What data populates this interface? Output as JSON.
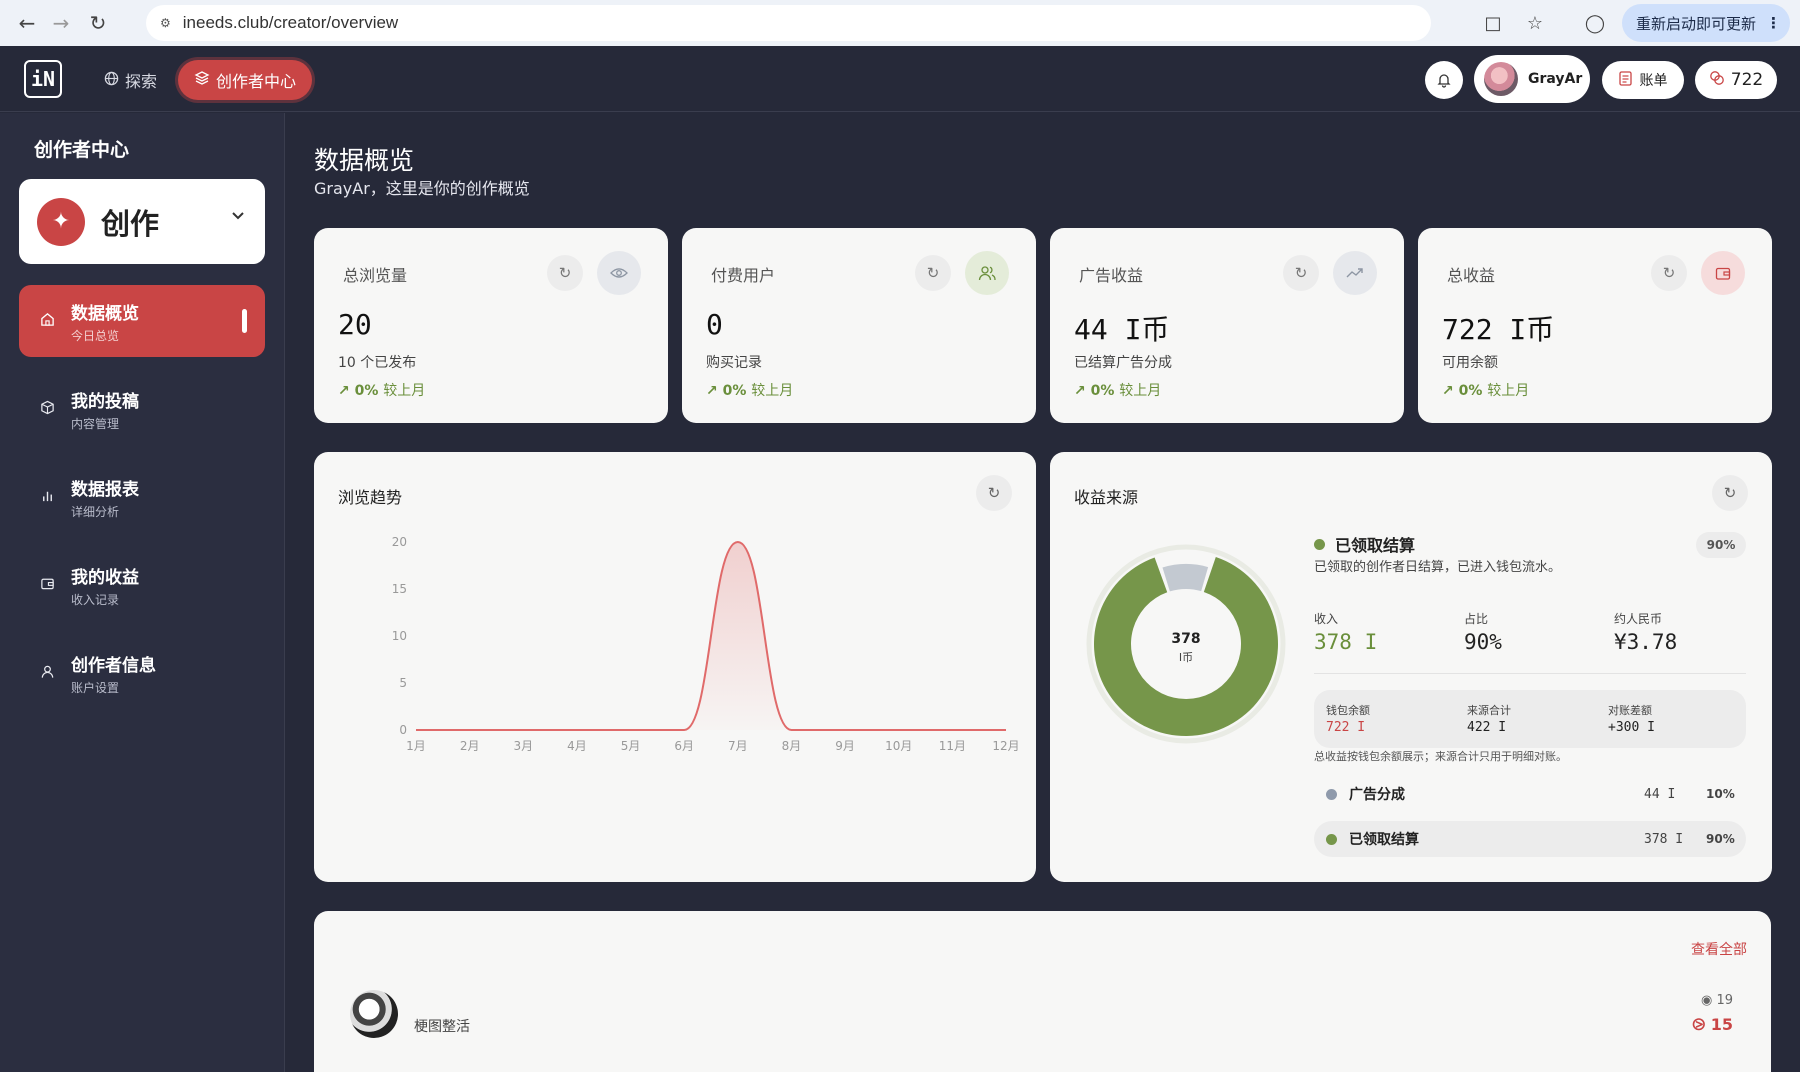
{
  "browser": {
    "url": "ineeds.club/creator/overview",
    "update_label": "重新启动即可更新"
  },
  "header": {
    "logo": "iN",
    "explore_label": "探索",
    "creator_label": "创作者中心",
    "username": "GrayAr",
    "bill_label": "账单",
    "coins": "722"
  },
  "sidebar": {
    "title": "创作者中心",
    "create_label": "创作",
    "items": [
      {
        "label": "数据概览",
        "sub": "今日总览",
        "icon": "home-icon"
      },
      {
        "label": "我的投稿",
        "sub": "内容管理",
        "icon": "box-icon"
      },
      {
        "label": "数据报表",
        "sub": "详细分析",
        "icon": "bar-chart-icon"
      },
      {
        "label": "我的收益",
        "sub": "收入记录",
        "icon": "wallet-icon"
      },
      {
        "label": "创作者信息",
        "sub": "账户设置",
        "icon": "user-icon"
      }
    ]
  },
  "main": {
    "title": "数据概览",
    "subtitle": "GrayAr，这里是你的创作概览",
    "stats": [
      {
        "label": "总浏览量",
        "value": "20",
        "desc": "10 个已发布",
        "change": "0%",
        "cmp": "较上月",
        "icon": "eye-icon"
      },
      {
        "label": "付费用户",
        "value": "0",
        "desc": "购买记录",
        "change": "0%",
        "cmp": "较上月",
        "icon": "users-icon"
      },
      {
        "label": "广告收益",
        "value": "44 I币",
        "desc": "已结算广告分成",
        "change": "0%",
        "cmp": "较上月",
        "icon": "trend-icon"
      },
      {
        "label": "总收益",
        "value": "722 I币",
        "desc": "可用余额",
        "change": "0%",
        "cmp": "较上月",
        "icon": "wallet-icon"
      }
    ]
  },
  "trend": {
    "title": "浏览趋势"
  },
  "chart_data": {
    "type": "area",
    "categories": [
      "1月",
      "2月",
      "3月",
      "4月",
      "5月",
      "6月",
      "7月",
      "8月",
      "9月",
      "10月",
      "11月",
      "12月"
    ],
    "values": [
      0,
      0,
      0,
      0,
      0,
      0,
      20,
      0,
      0,
      0,
      0,
      0
    ],
    "yticks": [
      "0",
      "5",
      "10",
      "15",
      "20"
    ],
    "ylim": [
      0,
      20
    ],
    "grid": false,
    "color": "#e06a6a"
  },
  "revenue": {
    "title": "收益来源",
    "donut_value": "378",
    "donut_unit": "I币",
    "donut_fraction": 0.9,
    "head_label": "已领取结算",
    "head_pct": "90%",
    "head_desc": "已领取的创作者日结算，已进入钱包流水。",
    "income_label": "收入",
    "income_value": "378 I",
    "share_label": "占比",
    "share_value": "90%",
    "rmb_label": "约人民币",
    "rmb_value": "¥3.78",
    "wallet_label": "钱包余额",
    "wallet_value": "722 I",
    "source_label": "来源合计",
    "source_value": "422 I",
    "diff_label": "对账差额",
    "diff_value": "+300 I",
    "note": "总收益按钱包余额展示；来源合计只用于明细对账。",
    "rows": [
      {
        "label": "广告分成",
        "amount": "44 I",
        "pct": "10%",
        "color": "#8f9aab"
      },
      {
        "label": "已领取结算",
        "amount": "378 I",
        "pct": "90%",
        "color": "#76964a"
      }
    ],
    "colors": {
      "green": "#76964a",
      "gray": "#c3c9d1"
    }
  },
  "recent": {
    "view_all": "查看全部",
    "item_name": "梗图整活",
    "item_views": "19",
    "item_coins": "15"
  }
}
